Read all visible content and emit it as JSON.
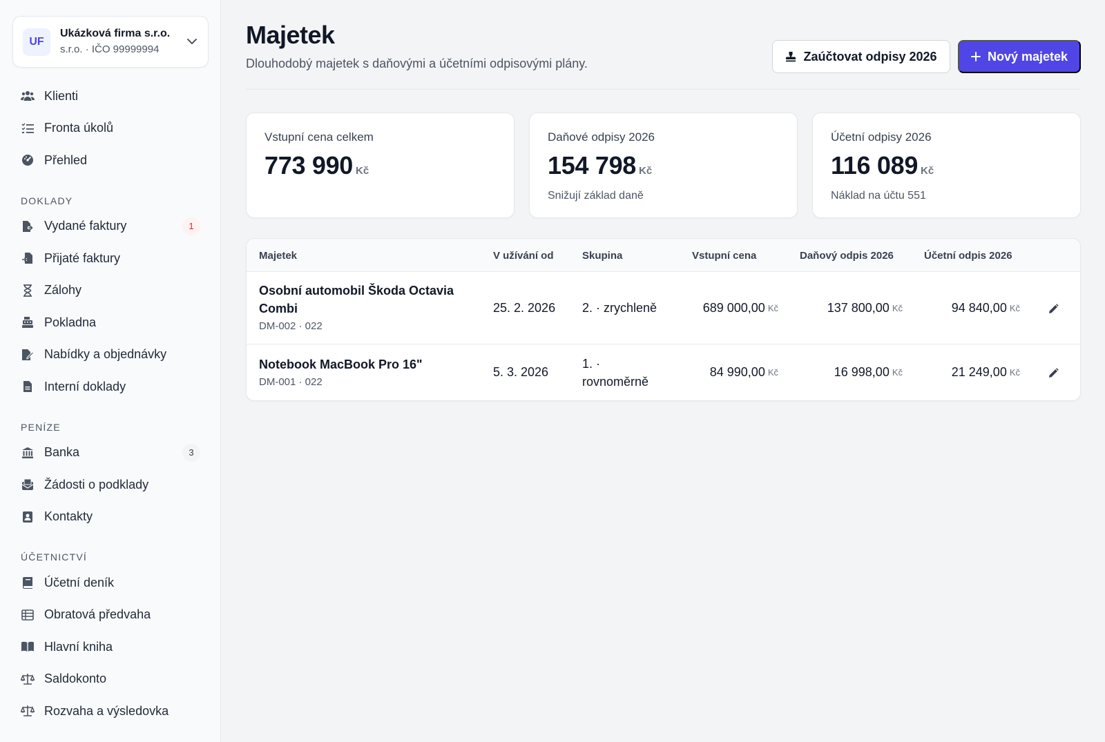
{
  "company": {
    "initials": "UF",
    "name": "Ukázková firma s.r.o.",
    "subtitle": "s.r.o. · IČO 99999994"
  },
  "nav": {
    "top": [
      {
        "label": "Klienti",
        "icon": "users-icon"
      },
      {
        "label": "Fronta úkolů",
        "icon": "task-list-icon"
      },
      {
        "label": "Přehled",
        "icon": "dashboard-icon"
      }
    ],
    "doklady_title": "DOKLADY",
    "doklady": [
      {
        "label": "Vydané faktury",
        "icon": "invoice-out-icon",
        "badge": "1"
      },
      {
        "label": "Přijaté faktury",
        "icon": "invoice-in-icon"
      },
      {
        "label": "Zálohy",
        "icon": "hourglass-icon"
      },
      {
        "label": "Pokladna",
        "icon": "cash-register-icon"
      },
      {
        "label": "Nabídky a objednávky",
        "icon": "offer-icon"
      },
      {
        "label": "Interní doklady",
        "icon": "document-icon"
      }
    ],
    "penize_title": "PENÍZE",
    "penize": [
      {
        "label": "Banka",
        "icon": "bank-icon",
        "badge": "3"
      },
      {
        "label": "Žádosti o podklady",
        "icon": "request-icon"
      },
      {
        "label": "Kontakty",
        "icon": "contacts-icon"
      }
    ],
    "ucetnictvi_title": "ÚČETNICTVÍ",
    "ucetnictvi": [
      {
        "label": "Účetní deník",
        "icon": "journal-icon"
      },
      {
        "label": "Obratová předvaha",
        "icon": "table-icon"
      },
      {
        "label": "Hlavní kniha",
        "icon": "book-icon"
      },
      {
        "label": "Saldokonto",
        "icon": "scale-icon"
      },
      {
        "label": "Rozvaha a výsledovka",
        "icon": "balance-icon"
      }
    ]
  },
  "page": {
    "title": "Majetek",
    "subtitle": "Dlouhodobý majetek s daňovými a účetními odpisovými plány.",
    "btn_post": "Zaúčtovat odpisy 2026",
    "btn_new": "Nový majetek"
  },
  "cards": [
    {
      "label": "Vstupní cena celkem",
      "value": "773 990",
      "unit": "Kč",
      "note": ""
    },
    {
      "label": "Daňové odpisy 2026",
      "value": "154 798",
      "unit": "Kč",
      "note": "Snižují základ daně"
    },
    {
      "label": "Účetní odpisy 2026",
      "value": "116 089",
      "unit": "Kč",
      "note": "Náklad na účtu 551"
    }
  ],
  "table": {
    "headers": [
      "Majetek",
      "V užívání od",
      "Skupina",
      "Vstupní cena",
      "Daňový odpis 2026",
      "Účetní odpis 2026"
    ],
    "currency": "Kč",
    "rows": [
      {
        "name": "Osobní automobil Škoda Octavia Combi",
        "code": "DM-002 · 022",
        "since": "25. 2. 2026",
        "group": "2. · zrychleně",
        "price": "689 000,00",
        "tax": "137 800,00",
        "acc": "94 840,00"
      },
      {
        "name": "Notebook MacBook Pro 16\"",
        "code": "DM-001 · 022",
        "since": "5. 3. 2026",
        "group": "1. · rovnoměrně",
        "price": "84 990,00",
        "tax": "16 998,00",
        "acc": "21 249,00"
      }
    ]
  },
  "colors": {
    "primary": "#4f46e5",
    "danger": "#dc2626"
  }
}
